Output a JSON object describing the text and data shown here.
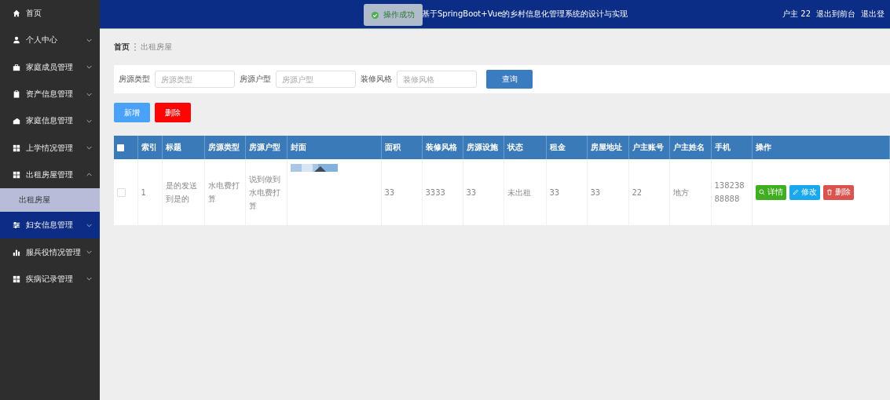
{
  "sidebar": {
    "items": [
      {
        "label": "首页",
        "hovered": false
      },
      {
        "label": "个人中心",
        "expandable": true,
        "expanded": false,
        "hovered": false
      },
      {
        "label": "家庭成员管理",
        "expandable": true,
        "expanded": false,
        "hovered": false
      },
      {
        "label": "资产信息管理",
        "expandable": true,
        "expanded": false,
        "hovered": false
      },
      {
        "label": "家庭信息管理",
        "expandable": true,
        "expanded": false,
        "hovered": false
      },
      {
        "label": "上学情况管理",
        "expandable": true,
        "expanded": false,
        "hovered": false
      },
      {
        "label": "出租房屋管理",
        "expandable": true,
        "expanded": true,
        "hovered": false,
        "children": [
          {
            "label": "出租房屋",
            "selected": true
          }
        ]
      },
      {
        "label": "妇女信息管理",
        "expandable": true,
        "expanded": false,
        "hovered": true
      },
      {
        "label": "服兵役情况管理",
        "expandable": true,
        "expanded": false,
        "hovered": false
      },
      {
        "label": "疾病记录管理",
        "expandable": true,
        "expanded": false,
        "hovered": false
      }
    ]
  },
  "toast": {
    "text": "操作成功"
  },
  "header": {
    "title": "基于SpringBoot+Vue的乡村信息化管理系统的设计与实现",
    "user": "户主 22",
    "links": [
      "退出到前台",
      "退出登"
    ]
  },
  "breadcrumb": [
    "首页",
    "出租房屋"
  ],
  "search": {
    "fields": [
      {
        "label": "房源类型",
        "placeholder": "房源类型"
      },
      {
        "label": "房源户型",
        "placeholder": "房源户型"
      },
      {
        "label": "装修风格",
        "placeholder": "装修风格"
      }
    ],
    "button": "查询"
  },
  "actions": {
    "add": "新增",
    "delete": "删除"
  },
  "table": {
    "header_checked": false,
    "columns": [
      "索引",
      "标题",
      "房源类型",
      "房源户型",
      "封面",
      "面积",
      "装修风格",
      "房源设施",
      "状态",
      "租金",
      "房屋地址",
      "户主账号",
      "户主姓名",
      "手机",
      "操作"
    ],
    "rows": [
      {
        "checked": false,
        "cells": [
          "1",
          "是的发送到是的",
          "水电费打算",
          "说到做到水电费打算",
          {
            "kind": "picture"
          },
          "33",
          "3333",
          "33",
          "未出租",
          "33",
          "33",
          "22",
          "地方",
          "13823888888"
        ],
        "buttons": [
          "详情",
          "修改",
          "删除"
        ]
      }
    ]
  }
}
